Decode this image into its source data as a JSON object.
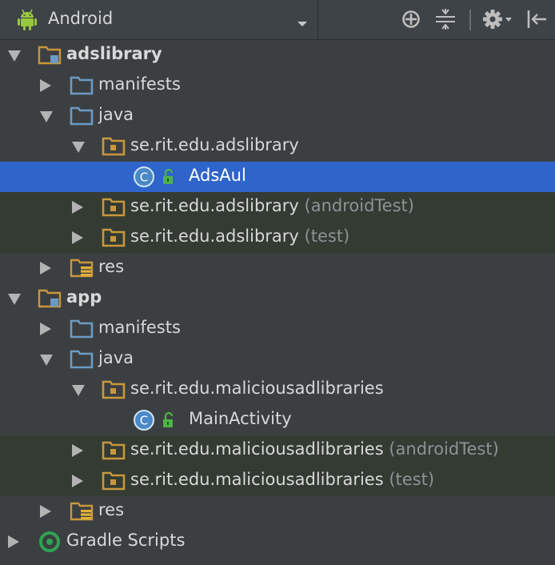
{
  "toolbar": {
    "view_mode": "Android",
    "icons": [
      "android-icon",
      "dropdown-icon",
      "scroll-from-source-icon",
      "collapse-all-icon",
      "gear-icon",
      "hide-panel-icon"
    ]
  },
  "tree": [
    {
      "label": "adslibrary",
      "suffix": "",
      "depth": 0,
      "expanded": true,
      "icon": "module-folder",
      "bold": true,
      "bg": "normal"
    },
    {
      "label": "manifests",
      "suffix": "",
      "depth": 1,
      "expanded": false,
      "icon": "folder",
      "bold": false,
      "bg": "normal"
    },
    {
      "label": "java",
      "suffix": "",
      "depth": 1,
      "expanded": true,
      "icon": "folder",
      "bold": false,
      "bg": "normal"
    },
    {
      "label": "se.rit.edu.adslibrary",
      "suffix": "",
      "depth": 2,
      "expanded": true,
      "icon": "package",
      "bold": false,
      "bg": "normal"
    },
    {
      "label": "AdsAul",
      "suffix": "",
      "depth": 3,
      "expanded": null,
      "icon": "class",
      "bold": false,
      "bg": "selected"
    },
    {
      "label": "se.rit.edu.adslibrary",
      "suffix": " (androidTest)",
      "depth": 2,
      "expanded": false,
      "icon": "package",
      "bold": false,
      "bg": "test"
    },
    {
      "label": "se.rit.edu.adslibrary",
      "suffix": " (test)",
      "depth": 2,
      "expanded": false,
      "icon": "package",
      "bold": false,
      "bg": "test"
    },
    {
      "label": "res",
      "suffix": "",
      "depth": 1,
      "expanded": false,
      "icon": "res-folder",
      "bold": false,
      "bg": "normal"
    },
    {
      "label": "app",
      "suffix": "",
      "depth": 0,
      "expanded": true,
      "icon": "module-folder",
      "bold": true,
      "bg": "normal"
    },
    {
      "label": "manifests",
      "suffix": "",
      "depth": 1,
      "expanded": false,
      "icon": "folder",
      "bold": false,
      "bg": "normal"
    },
    {
      "label": "java",
      "suffix": "",
      "depth": 1,
      "expanded": true,
      "icon": "folder",
      "bold": false,
      "bg": "normal"
    },
    {
      "label": "se.rit.edu.maliciousadlibraries",
      "suffix": "",
      "depth": 2,
      "expanded": true,
      "icon": "package",
      "bold": false,
      "bg": "normal"
    },
    {
      "label": "MainActivity",
      "suffix": "",
      "depth": 3,
      "expanded": null,
      "icon": "class",
      "bold": false,
      "bg": "normal"
    },
    {
      "label": "se.rit.edu.maliciousadlibraries",
      "suffix": " (androidTest)",
      "depth": 2,
      "expanded": false,
      "icon": "package",
      "bold": false,
      "bg": "test"
    },
    {
      "label": "se.rit.edu.maliciousadlibraries",
      "suffix": " (test)",
      "depth": 2,
      "expanded": false,
      "icon": "package",
      "bold": false,
      "bg": "test"
    },
    {
      "label": "res",
      "suffix": "",
      "depth": 1,
      "expanded": false,
      "icon": "res-folder",
      "bold": false,
      "bg": "normal"
    },
    {
      "label": "Gradle Scripts",
      "suffix": "",
      "depth": 0,
      "expanded": false,
      "icon": "gradle",
      "bold": false,
      "bg": "normal"
    }
  ],
  "colors": {
    "background": "#3c3f41",
    "selected": "#2f65ca",
    "test_bg": "#333b33",
    "folder_blue": "#6b9bc3",
    "package_orange": "#c9973b",
    "android_green": "#98c83d",
    "class_blue": "#3f98d8",
    "gradle_green": "#2ea353"
  }
}
